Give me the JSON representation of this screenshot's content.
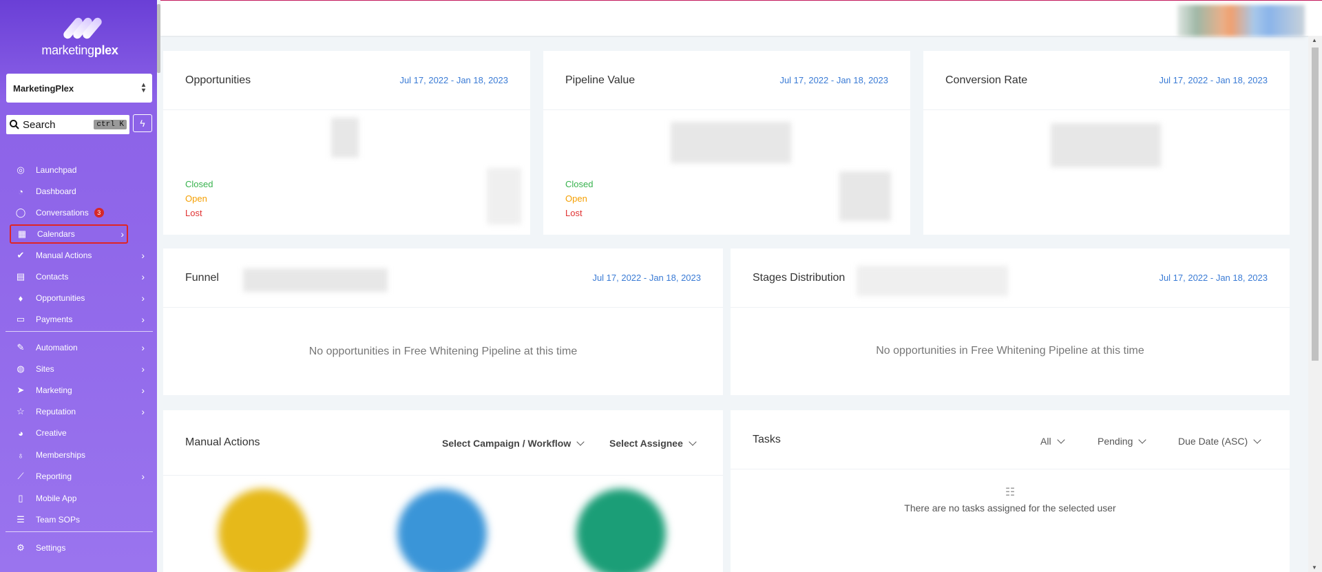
{
  "brand": {
    "name_light": "marketing",
    "name_bold": "plex"
  },
  "account": {
    "selected": "MarketingPlex"
  },
  "search": {
    "label": "Search",
    "shortcut": "ctrl K"
  },
  "nav": [
    {
      "id": "launchpad",
      "label": "Launchpad",
      "icon": "rocket-icon",
      "glyph": "◎",
      "chevron": false
    },
    {
      "id": "dashboard",
      "label": "Dashboard",
      "icon": "gauge-icon",
      "glyph": "◔",
      "chevron": false
    },
    {
      "id": "conversations",
      "label": "Conversations",
      "icon": "chat-icon",
      "glyph": "◯",
      "chevron": false,
      "badge": "3"
    },
    {
      "id": "calendars",
      "label": "Calendars",
      "icon": "calendar-icon",
      "glyph": "▦",
      "chevron": true,
      "active": true
    },
    {
      "id": "manual-actions",
      "label": "Manual Actions",
      "icon": "check-circle-icon",
      "glyph": "✔",
      "chevron": true
    },
    {
      "id": "contacts",
      "label": "Contacts",
      "icon": "contact-book-icon",
      "glyph": "▤",
      "chevron": true
    },
    {
      "id": "opportunities",
      "label": "Opportunities",
      "icon": "flame-icon",
      "glyph": "♦",
      "chevron": true
    },
    {
      "id": "payments",
      "label": "Payments",
      "icon": "credit-card-icon",
      "glyph": "▭",
      "chevron": true
    },
    {
      "id": "automation",
      "label": "Automation",
      "icon": "magic-wand-icon",
      "glyph": "✎",
      "chevron": true
    },
    {
      "id": "sites",
      "label": "Sites",
      "icon": "globe-icon",
      "glyph": "◍",
      "chevron": true
    },
    {
      "id": "marketing",
      "label": "Marketing",
      "icon": "paper-plane-icon",
      "glyph": "➤",
      "chevron": true
    },
    {
      "id": "reputation",
      "label": "Reputation",
      "icon": "star-icon",
      "glyph": "☆",
      "chevron": true
    },
    {
      "id": "creative",
      "label": "Creative",
      "icon": "palette-icon",
      "glyph": "◕",
      "chevron": false
    },
    {
      "id": "memberships",
      "label": "Memberships",
      "icon": "award-icon",
      "glyph": "♁",
      "chevron": false
    },
    {
      "id": "reporting",
      "label": "Reporting",
      "icon": "chart-line-icon",
      "glyph": "⟋",
      "chevron": true
    },
    {
      "id": "mobile-app",
      "label": "Mobile App",
      "icon": "phone-icon",
      "glyph": "▯",
      "chevron": false
    },
    {
      "id": "team-sops",
      "label": "Team SOPs",
      "icon": "list-check-icon",
      "glyph": "☰",
      "chevron": false
    },
    {
      "id": "settings",
      "label": "Settings",
      "icon": "gear-icon",
      "glyph": "⚙",
      "chevron": false
    }
  ],
  "cards": {
    "opportunities": {
      "title": "Opportunities",
      "date": "Jul 17, 2022 - Jan 18, 2023",
      "legend": [
        "Closed",
        "Open",
        "Lost"
      ]
    },
    "pipeline": {
      "title": "Pipeline Value",
      "date": "Jul 17, 2022 - Jan 18, 2023",
      "legend": [
        "Closed",
        "Open",
        "Lost"
      ]
    },
    "conversion": {
      "title": "Conversion Rate",
      "date": "Jul 17, 2022 - Jan 18, 2023"
    },
    "funnel": {
      "title": "Funnel",
      "date": "Jul 17, 2022 - Jan 18, 2023",
      "empty": "No opportunities in Free Whitening Pipeline at this time"
    },
    "stages": {
      "title": "Stages Distribution",
      "date": "Jul 17, 2022 - Jan 18, 2023",
      "empty": "No opportunities in Free Whitening Pipeline at this time"
    },
    "manual_actions": {
      "title": "Manual Actions",
      "campaign_filter": "Select Campaign / Workflow",
      "assignee_filter": "Select Assignee",
      "circle_colors": [
        "#e6b91a",
        "#3a95d8",
        "#1b9e77"
      ]
    },
    "tasks": {
      "title": "Tasks",
      "filter_all": "All",
      "filter_status": "Pending",
      "filter_sort": "Due Date (ASC)",
      "empty": "There are no tasks assigned for the selected user"
    }
  },
  "colors": {
    "accent": "#3a7bd5",
    "closed": "#37b24d",
    "open": "#f59f00",
    "lost": "#e03131",
    "badge": "#d62828"
  }
}
